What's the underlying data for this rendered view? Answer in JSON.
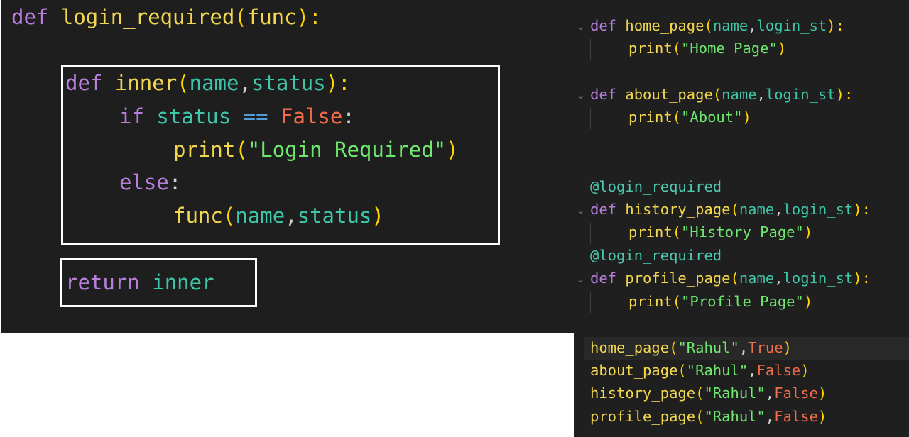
{
  "left": {
    "l1": {
      "kw": "def",
      "name": "login_required",
      "open": "(",
      "param": "func",
      "close": "):"
    },
    "l2": {
      "kw": "def",
      "name": "inner",
      "open": "(",
      "p1": "name",
      "comma": ",",
      "p2": "status",
      "close": "):"
    },
    "l3": {
      "kw": "if",
      "var": "status",
      "op": "==",
      "val": "False",
      "colon": ":"
    },
    "l4": {
      "fn": "print",
      "open": "(",
      "str": "\"Login Required\"",
      "close": ")"
    },
    "l5": {
      "kw": "else",
      "colon": ":"
    },
    "l6": {
      "fn": "func",
      "open": "(",
      "p1": "name",
      "comma": ",",
      "p2": "status",
      "close": ")"
    },
    "l7": {
      "kw": "return",
      "val": "inner"
    }
  },
  "right": {
    "r1": {
      "kw": "def",
      "name": "home_page",
      "open": "(",
      "p1": "name",
      "comma": ",",
      "p2": "login_st",
      "close": "):"
    },
    "r2": {
      "fn": "print",
      "open": "(",
      "str": "\"Home Page\"",
      "close": ")"
    },
    "r3": {
      "kw": "def",
      "name": "about_page",
      "open": "(",
      "p1": "name",
      "comma": ",",
      "p2": "login_st",
      "close": "):"
    },
    "r4": {
      "fn": "print",
      "open": "(",
      "str": "\"About\"",
      "close": ")"
    },
    "r5": {
      "dec": "@login_required"
    },
    "r6": {
      "kw": "def",
      "name": "history_page",
      "open": "(",
      "p1": "name",
      "comma": ",",
      "p2": "login_st",
      "close": "):"
    },
    "r7": {
      "fn": "print",
      "open": "(",
      "str": "\"History Page\"",
      "close": ")"
    },
    "r8": {
      "dec": "@login_required"
    },
    "r9": {
      "kw": "def",
      "name": "profile_page",
      "open": "(",
      "p1": "name",
      "comma": ",",
      "p2": "login_st",
      "close": "):"
    },
    "r10": {
      "fn": "print",
      "open": "(",
      "str": "\"Profile Page\"",
      "close": ")"
    },
    "c1": {
      "fn": "home_page",
      "open": "(",
      "str": "\"Rahul\"",
      "comma": ",",
      "val": "True",
      "close": ")"
    },
    "c2": {
      "fn": "about_page",
      "open": "(",
      "str": "\"Rahul\"",
      "comma": ",",
      "val": "False",
      "close": ")"
    },
    "c3": {
      "fn": "history_page",
      "open": "(",
      "str": "\"Rahul\"",
      "comma": ",",
      "val": "False",
      "close": ")"
    },
    "c4": {
      "fn": "profile_page",
      "open": "(",
      "str": "\"Rahul\"",
      "comma": ",",
      "val": "False",
      "close": ")"
    }
  },
  "icons": {
    "fold": "chevron-down-icon"
  }
}
